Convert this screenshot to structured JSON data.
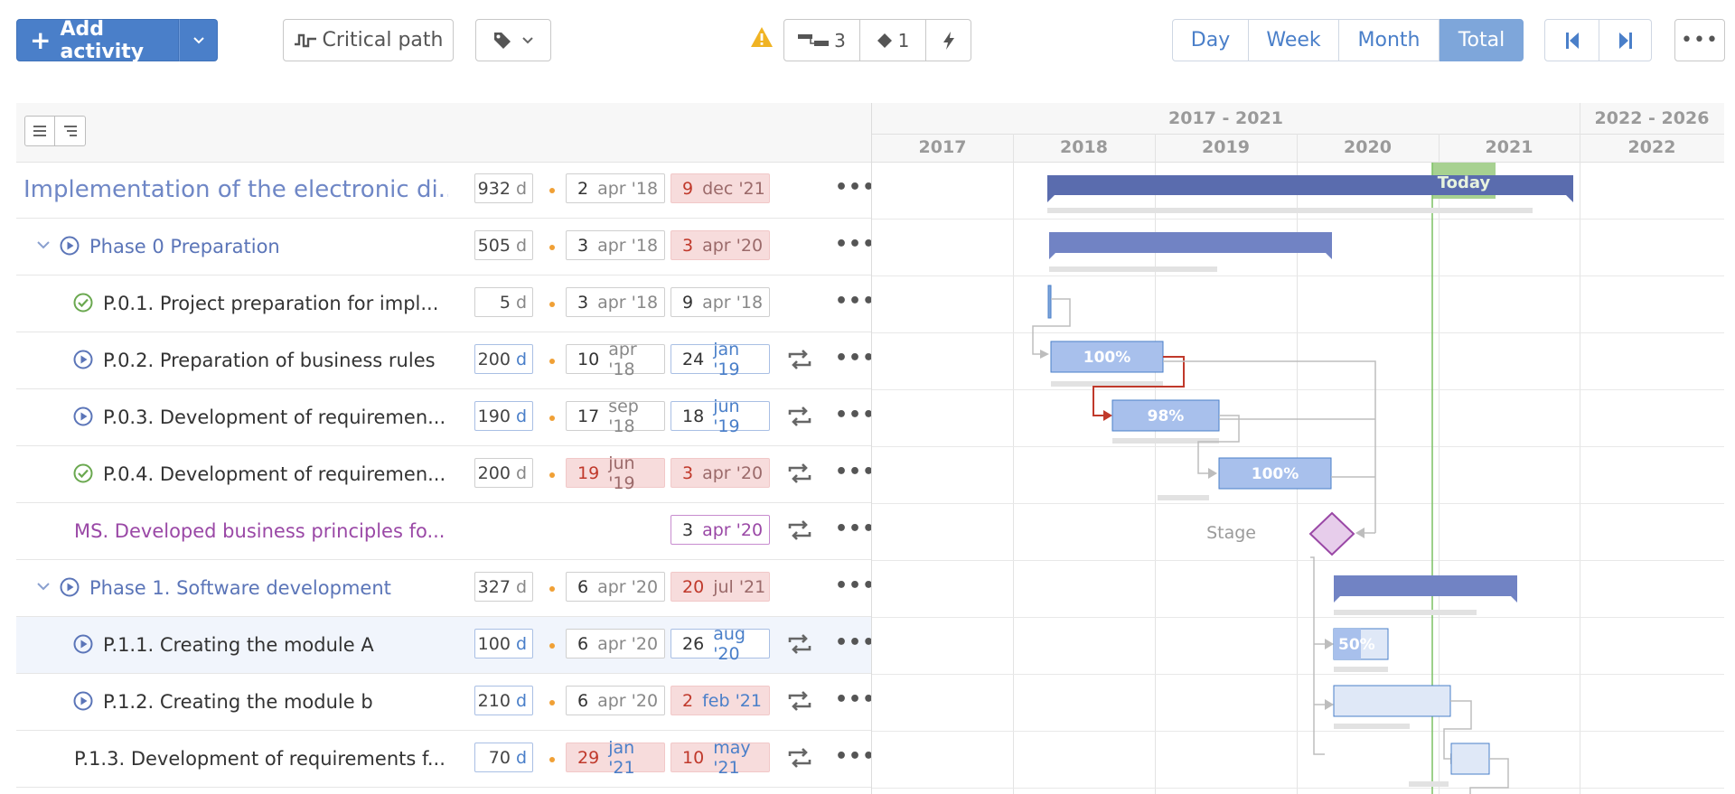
{
  "toolbar": {
    "add_label": "Add activity",
    "critical_path_label": "Critical path",
    "seg_links": "3",
    "seg_milestones": "1",
    "views": [
      "Day",
      "Week",
      "Month",
      "Total"
    ],
    "active_view": "Total",
    "more": "•••"
  },
  "timeline": {
    "groups": [
      "2017 - 2021",
      "2022 - 2026"
    ],
    "years": [
      "2017",
      "2018",
      "2019",
      "2020",
      "2021",
      "2022"
    ],
    "today_label": "Today",
    "stage_label": "Stage"
  },
  "rows": [
    {
      "name": "Implementation of the electronic di...",
      "duration": "932",
      "unit": "d",
      "start_day": "2",
      "start_mon": "apr '18",
      "end_day": "9",
      "end_mon": "dec '21"
    },
    {
      "name": "Phase 0 Preparation",
      "duration": "505",
      "unit": "d",
      "start_day": "3",
      "start_mon": "apr '18",
      "end_day": "3",
      "end_mon": "apr '20"
    },
    {
      "name": "P.0.1. Project preparation for impl...",
      "duration": "5",
      "unit": "d",
      "start_day": "3",
      "start_mon": "apr '18",
      "end_day": "9",
      "end_mon": "apr '18"
    },
    {
      "name": "P.0.2. Preparation of business rules",
      "duration": "200",
      "unit": "d",
      "start_day": "10",
      "start_mon": "apr '18",
      "end_day": "24",
      "end_mon": "jan '19",
      "pct": "100%"
    },
    {
      "name": "P.0.3. Development of requiremen...",
      "duration": "190",
      "unit": "d",
      "start_day": "17",
      "start_mon": "sep '18",
      "end_day": "18",
      "end_mon": "jun '19",
      "pct": "98%"
    },
    {
      "name": "P.0.4. Development of requiremen...",
      "duration": "200",
      "unit": "d",
      "start_day": "19",
      "start_mon": "jun '19",
      "end_day": "3",
      "end_mon": "apr '20",
      "pct": "100%"
    },
    {
      "name": "MS. Developed business principles fo...",
      "end_day": "3",
      "end_mon": "apr '20"
    },
    {
      "name": "Phase 1. Software development",
      "duration": "327",
      "unit": "d",
      "start_day": "6",
      "start_mon": "apr '20",
      "end_day": "20",
      "end_mon": "jul '21"
    },
    {
      "name": "P.1.1. Creating the module A",
      "duration": "100",
      "unit": "d",
      "start_day": "6",
      "start_mon": "apr '20",
      "end_day": "26",
      "end_mon": "aug '20",
      "pct": "50%"
    },
    {
      "name": "P.1.2. Creating the module b",
      "duration": "210",
      "unit": "d",
      "start_day": "6",
      "start_mon": "apr '20",
      "end_day": "2",
      "end_mon": "feb '21"
    },
    {
      "name": "P.1.3. Development of requirements f...",
      "duration": "70",
      "unit": "d",
      "start_day": "29",
      "start_mon": "jan '21",
      "end_day": "10",
      "end_mon": "may '21"
    }
  ]
}
